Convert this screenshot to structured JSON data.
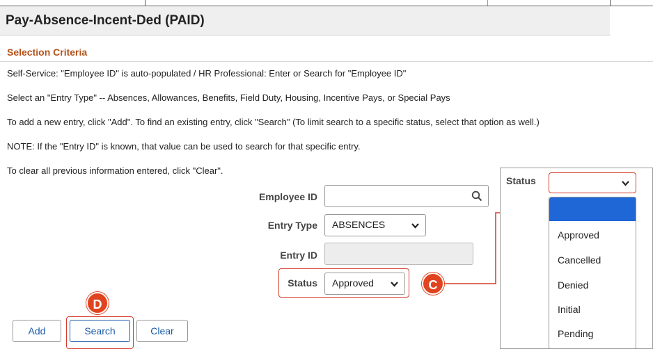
{
  "background": {
    "status_label": "Status"
  },
  "page": {
    "title": "Pay-Absence-Incent-Ded (PAID)",
    "section_title": "Selection Criteria",
    "instructions": [
      "Self-Service: \"Employee ID\" is auto-populated / HR Professional: Enter or Search for \"Employee ID\"",
      "Select an \"Entry Type\" -- Absences, Allowances, Benefits, Field Duty, Housing, Incentive Pays, or Special Pays",
      "To add a new entry, click \"Add\". To find an existing entry, click \"Search\" (To limit search to a specific status, select that option as well.)",
      "NOTE: If the \"Entry ID\" is known, that value can be used to search for that specific entry.",
      "To clear all previous information entered, click \"Clear\"."
    ]
  },
  "form": {
    "employee_id_label": "Employee ID",
    "employee_id_value": "",
    "entry_type_label": "Entry Type",
    "entry_type_value": "ABSENCES",
    "entry_id_label": "Entry ID",
    "entry_id_value": "",
    "status_label": "Status",
    "status_value": "Approved"
  },
  "buttons": {
    "add": "Add",
    "search": "Search",
    "clear": "Clear"
  },
  "callouts": {
    "c": "C",
    "d": "D"
  },
  "dropdown": {
    "label": "Status",
    "selected_value": "",
    "options": [
      "",
      "Approved",
      "Cancelled",
      "Denied",
      "Initial",
      "Pending"
    ]
  },
  "colors": {
    "accent_orange": "#b5531b",
    "callout_red": "#e0441f",
    "highlight_red": "#d43c2b",
    "link_blue": "#1a5aa8",
    "selected_blue": "#1f66d6"
  }
}
